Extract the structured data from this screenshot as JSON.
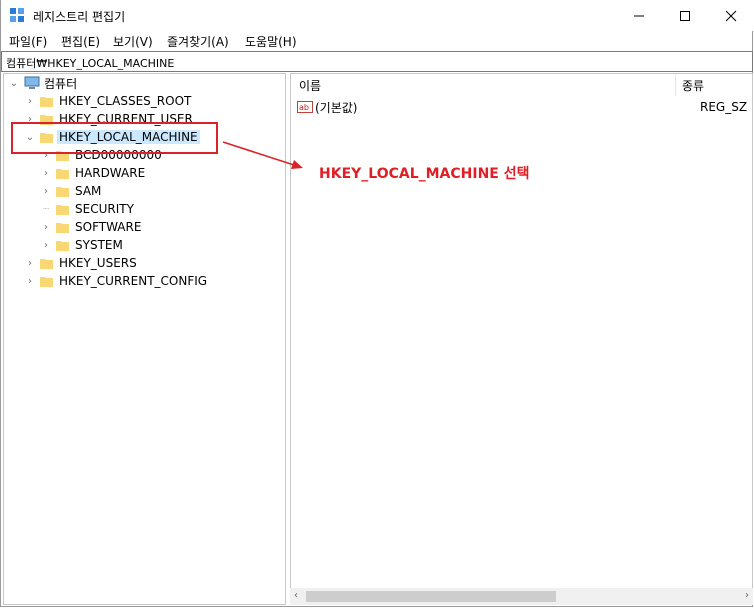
{
  "window": {
    "title": "레지스트리 편집기"
  },
  "menu": [
    {
      "label": "파일(F)"
    },
    {
      "label": "편집(E)"
    },
    {
      "label": "보기(V)"
    },
    {
      "label": "즐겨찾기(A)"
    },
    {
      "label": "도움말(H)"
    }
  ],
  "address": {
    "value": "컴퓨터₩HKEY_LOCAL_MACHINE"
  },
  "tree": {
    "root": "컴퓨터",
    "items": [
      {
        "label": "HKEY_CLASSES_ROOT"
      },
      {
        "label": "HKEY_CURRENT_USER"
      },
      {
        "label": "HKEY_LOCAL_MACHINE"
      },
      {
        "label": "BCD00000000"
      },
      {
        "label": "HARDWARE"
      },
      {
        "label": "SAM"
      },
      {
        "label": "SECURITY"
      },
      {
        "label": "SOFTWARE"
      },
      {
        "label": "SYSTEM"
      },
      {
        "label": "HKEY_USERS"
      },
      {
        "label": "HKEY_CURRENT_CONFIG"
      }
    ]
  },
  "list": {
    "columns": {
      "name": "이름",
      "type": "종류"
    },
    "rows": [
      {
        "name": "(기본값)",
        "type": "REG_SZ"
      }
    ]
  },
  "annotation": {
    "text": "HKEY_LOCAL_MACHINE 선택",
    "color": "#e01e25"
  },
  "colors": {
    "selection": "#cce8ff",
    "folder": "#f8d775"
  }
}
